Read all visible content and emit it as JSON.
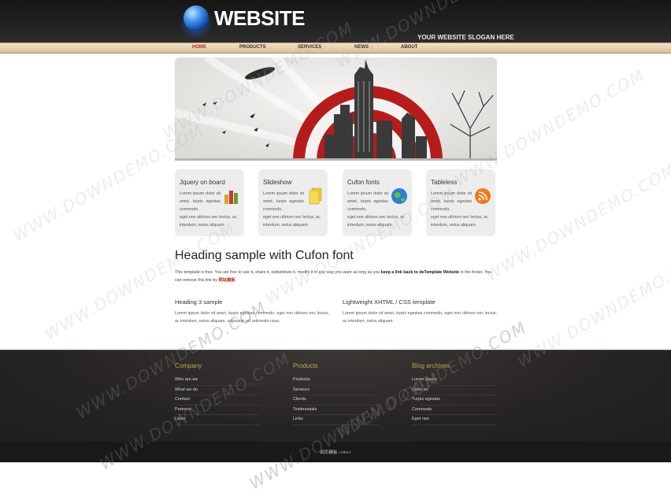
{
  "header": {
    "logo_text": "WEBSITE",
    "slogan": "YOUR WEBSITE SLOGAN HERE"
  },
  "nav": {
    "items": [
      "HOME",
      "PRODUCTS",
      "SERVICES",
      "NEWS",
      "ABOUT"
    ],
    "active": "HOME"
  },
  "features": [
    {
      "title": "Jquery on board",
      "icon": "bar-chart-icon",
      "text": "Lorem ipsum dolor sit amet, turpis egestas commodo,",
      "text2": "eget non ultrices nec lectus, ac interdum, netus aliquam."
    },
    {
      "title": "Slideshow",
      "icon": "documents-icon",
      "text": "Lorem ipsum dolor sit amet, turpis egestas commodo,",
      "text2": "eget non ultrices nec lectus, ac interdum, netus aliquam."
    },
    {
      "title": "Cufon fonts",
      "icon": "globe-icon",
      "text": "Lorem ipsum dolor sit amet, turpis egestas commodo,",
      "text2": "eget non ultrices nec lectus, ac interdum, netus aliquam."
    },
    {
      "title": "Tableless",
      "icon": "rss-icon",
      "text": "Lorem ipsum dolor sit amet, turpis egestas commodo,",
      "text2": "eget non ultrices nec lectus, ac interdum, netus aliquam."
    }
  ],
  "main": {
    "heading": "Heading sample with Cufon font",
    "intro_before": "This template is free. You are free to use it, share it, redistribute it, modify it in any way you want as long as you ",
    "intro_bold": "keep a link back to deTemplate Website",
    "intro_after": " in the footer. You can remove this link by ",
    "intro_link": "网站模板",
    "intro_end": ".",
    "col1_heading": "Heading 3 sample",
    "col1_text": "Lorem ipsum dolor sit amet, turpis egestas commodo, eget non ultrices nec lectus, ac interdum, netus aliquam, vulputate vel reticendo risus.",
    "col2_heading": "Lightweight XHTML / CSS template",
    "col2_text": "Lorem ipsum dolor sit amet, turpis egestas commodo, eget non ultrices nec lectus, ac interdum, netus aliquam."
  },
  "footer": {
    "columns": [
      {
        "heading": "Company",
        "links": [
          "Who are we",
          "What we do",
          "Contact",
          "Partners",
          "Links"
        ]
      },
      {
        "heading": "Products",
        "links": [
          "Products",
          "Services",
          "Clients",
          "Testimonials",
          "Links"
        ]
      },
      {
        "heading": "Blog archives",
        "links": [
          "Lorem ipsum",
          "Dolor sit",
          "Turpis egestas",
          "Commodo",
          "Eget non"
        ]
      }
    ],
    "copyright_link": "网页模板",
    "copyright_text": " collect"
  },
  "watermark": "WWW.DOWNDEMO.COM"
}
